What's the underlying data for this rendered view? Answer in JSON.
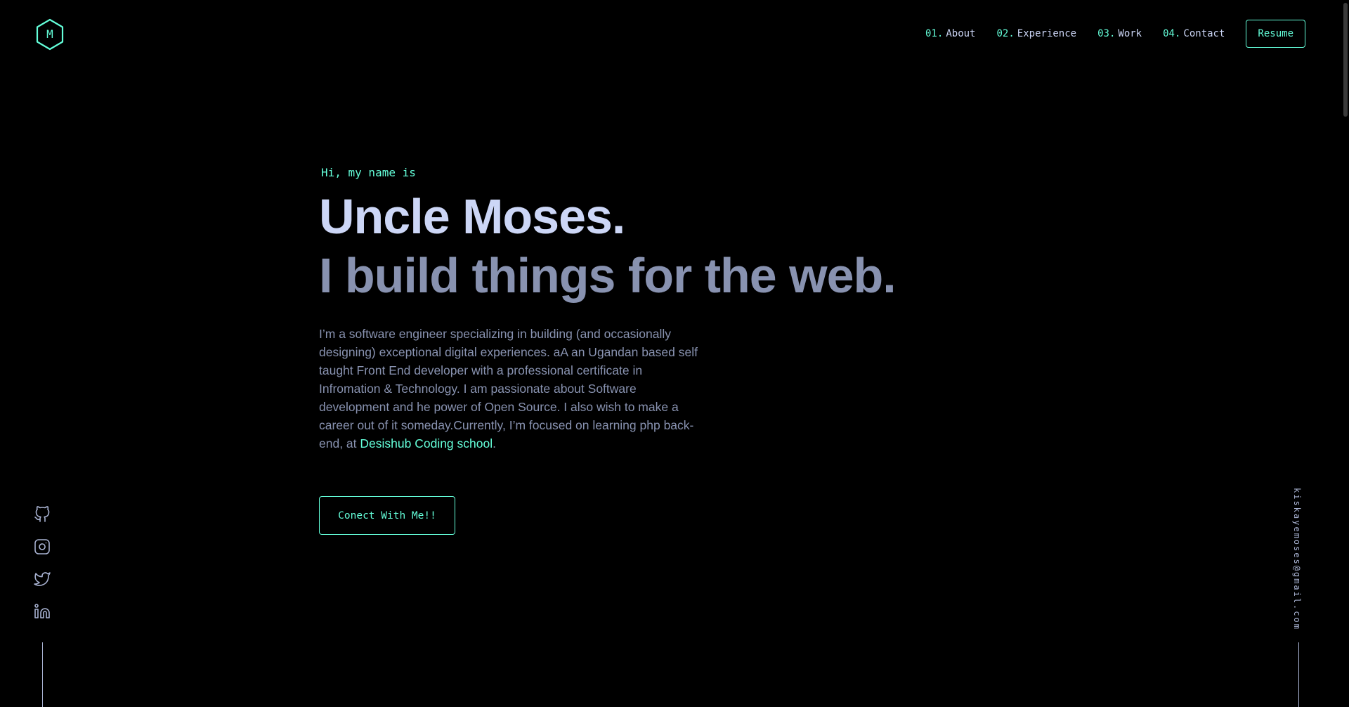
{
  "brand": {
    "logo_letter": "M",
    "accent_color": "#64ffda",
    "background_color": "#000000",
    "heading_color": "#ccd6f6",
    "text_color": "#8892b0"
  },
  "nav": {
    "items": [
      {
        "num": "01.",
        "label": "About"
      },
      {
        "num": "02.",
        "label": "Experience"
      },
      {
        "num": "03.",
        "label": "Work"
      },
      {
        "num": "04.",
        "label": "Contact"
      }
    ],
    "resume_label": "Resume"
  },
  "hero": {
    "greeting": "Hi, my name is",
    "name": "Uncle Moses.",
    "tagline": "I build things for the web.",
    "bio_text": "I’m a software engineer specializing in building (and occasionally designing) exceptional digital experiences. aA an Ugandan based self taught Front End developer with a professional certificate in Infromation & Technology. I am passionate about Software development and he power of Open Source. I also wish to make a career out of it someday.Currently, I’m focused on learning php back-end, at ",
    "bio_link": "Desishub Coding school",
    "bio_end": ".",
    "cta_label": "Conect With Me!!"
  },
  "socials": [
    "github-icon",
    "instagram-icon",
    "twitter-icon",
    "linkedin-icon"
  ],
  "email": "kiskayemoses@gmail.com"
}
